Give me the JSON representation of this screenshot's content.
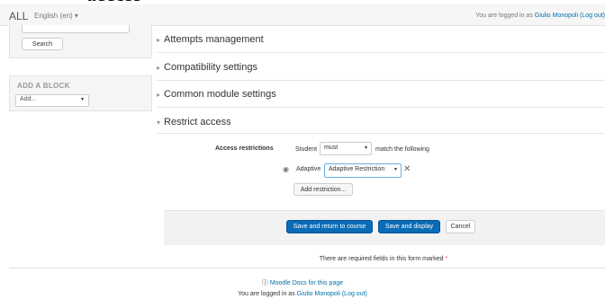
{
  "heading_fragment": "access",
  "navbar": {
    "brand": "ALL",
    "language": "English (en)",
    "language_caret": "▾",
    "logged_in_prefix": "You are logged in as ",
    "user_name": "Giulio Monopoli",
    "logout": "(Log out)"
  },
  "left": {
    "search_button": "Search",
    "add_block_title": "ADD A BLOCK",
    "add_block_select": "Add...",
    "caret": "▾"
  },
  "sections": [
    {
      "label": "Attempts management",
      "expanded": false
    },
    {
      "label": "Compatibility settings",
      "expanded": false
    },
    {
      "label": "Common module settings",
      "expanded": false
    },
    {
      "label": "Restrict access",
      "expanded": true
    }
  ],
  "icons": {
    "collapsed": "▸",
    "expanded": "▾",
    "eye": "◉",
    "remove": "✕"
  },
  "restrict": {
    "label": "Access restrictions",
    "student": "Student",
    "must_select": "must",
    "match_text": "match the following",
    "condition_name": "Adaptive",
    "condition_select": "Adaptive Restriction",
    "add_restriction": "Add restriction..."
  },
  "buttons": {
    "save_return": "Save and return to course",
    "save_display": "Save and display",
    "cancel": "Cancel"
  },
  "required_text": "There are required fields in this form marked",
  "required_star": "*",
  "footer": {
    "docs_icon": "ⓘ",
    "docs_link": "Moodle Docs for this page",
    "logged_in_prefix": "You are logged in as ",
    "user_name": "Giulio Monopoli",
    "logout": "(Log out)"
  },
  "colors": {
    "link": "#0070a8",
    "primary": "#0a6bb6",
    "required": "#d9534f"
  }
}
